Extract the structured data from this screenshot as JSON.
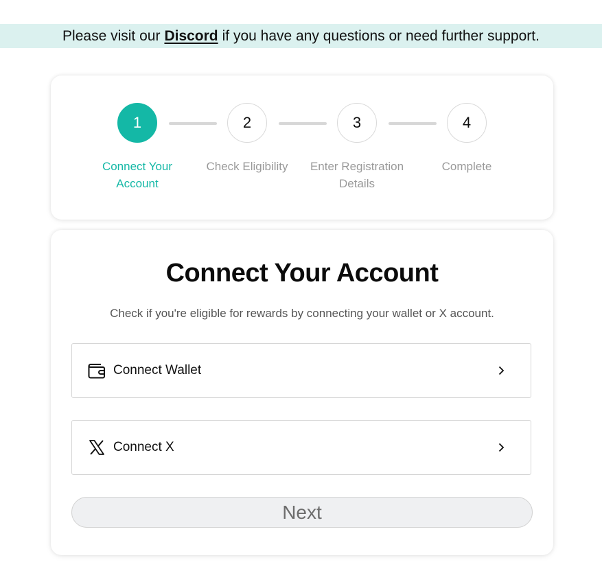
{
  "banner": {
    "prefix": "Please visit our",
    "link_label": "Discord",
    "suffix": "if you have any questions or need further support."
  },
  "stepper": {
    "active_color": "#14b8a6",
    "steps": [
      {
        "number": "1",
        "label": "Connect Your Account",
        "state": "active"
      },
      {
        "number": "2",
        "label": "Check Eligibility",
        "state": "inactive"
      },
      {
        "number": "3",
        "label": "Enter Registration Details",
        "state": "inactive"
      },
      {
        "number": "4",
        "label": "Complete",
        "state": "inactive"
      }
    ]
  },
  "main": {
    "title": "Connect Your Account",
    "subtitle": "Check if you're eligible for rewards by connecting your wallet or X account.",
    "options": [
      {
        "label": "Connect Wallet",
        "icon": "wallet-icon",
        "trailing_icon": "chevron-right-icon"
      },
      {
        "label": "Connect X",
        "icon": "x-logo-icon",
        "trailing_icon": "chevron-right-icon"
      }
    ],
    "next_label": "Next"
  }
}
